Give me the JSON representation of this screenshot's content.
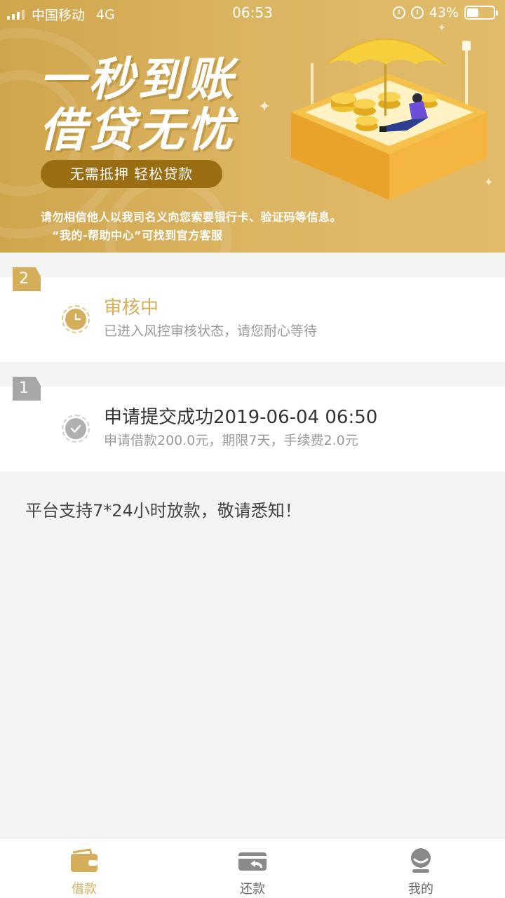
{
  "status_bar": {
    "carrier": "中国移动",
    "network": "4G",
    "time": "06:53",
    "battery": "43%"
  },
  "banner": {
    "headline_line1": "一秒到账",
    "headline_line2": "借贷无忧",
    "pill_text": "无需抵押  轻松贷款",
    "notice_line1": "请勿相信他人以我司名义向您索要银行卡、验证码等信息。",
    "notice_line2": "“我的-帮助中心”可找到官方客服"
  },
  "steps": [
    {
      "number": "2",
      "title": "审核中",
      "subtitle": "已进入风控审核状态，请您耐心等待",
      "state": "in-progress",
      "icon": "clock-icon",
      "color": "#d4ae5a"
    },
    {
      "number": "1",
      "title": "申请提交成功2019-06-04 06:50",
      "subtitle": "申请借款200.0元，期限7天，手续费2.0元",
      "state": "done",
      "icon": "check-icon",
      "color": "#b0b0b0"
    }
  ],
  "footnote": "平台支持7*24小时放款，敬请悉知！",
  "tabs": [
    {
      "label": "借款",
      "icon": "wallet-icon",
      "active": true
    },
    {
      "label": "还款",
      "icon": "card-return-icon",
      "active": false
    },
    {
      "label": "我的",
      "icon": "user-icon",
      "active": false
    }
  ],
  "colors": {
    "accent": "#d4ae5a",
    "inactive": "#8a8a8a",
    "pill": "#9b6d12"
  }
}
